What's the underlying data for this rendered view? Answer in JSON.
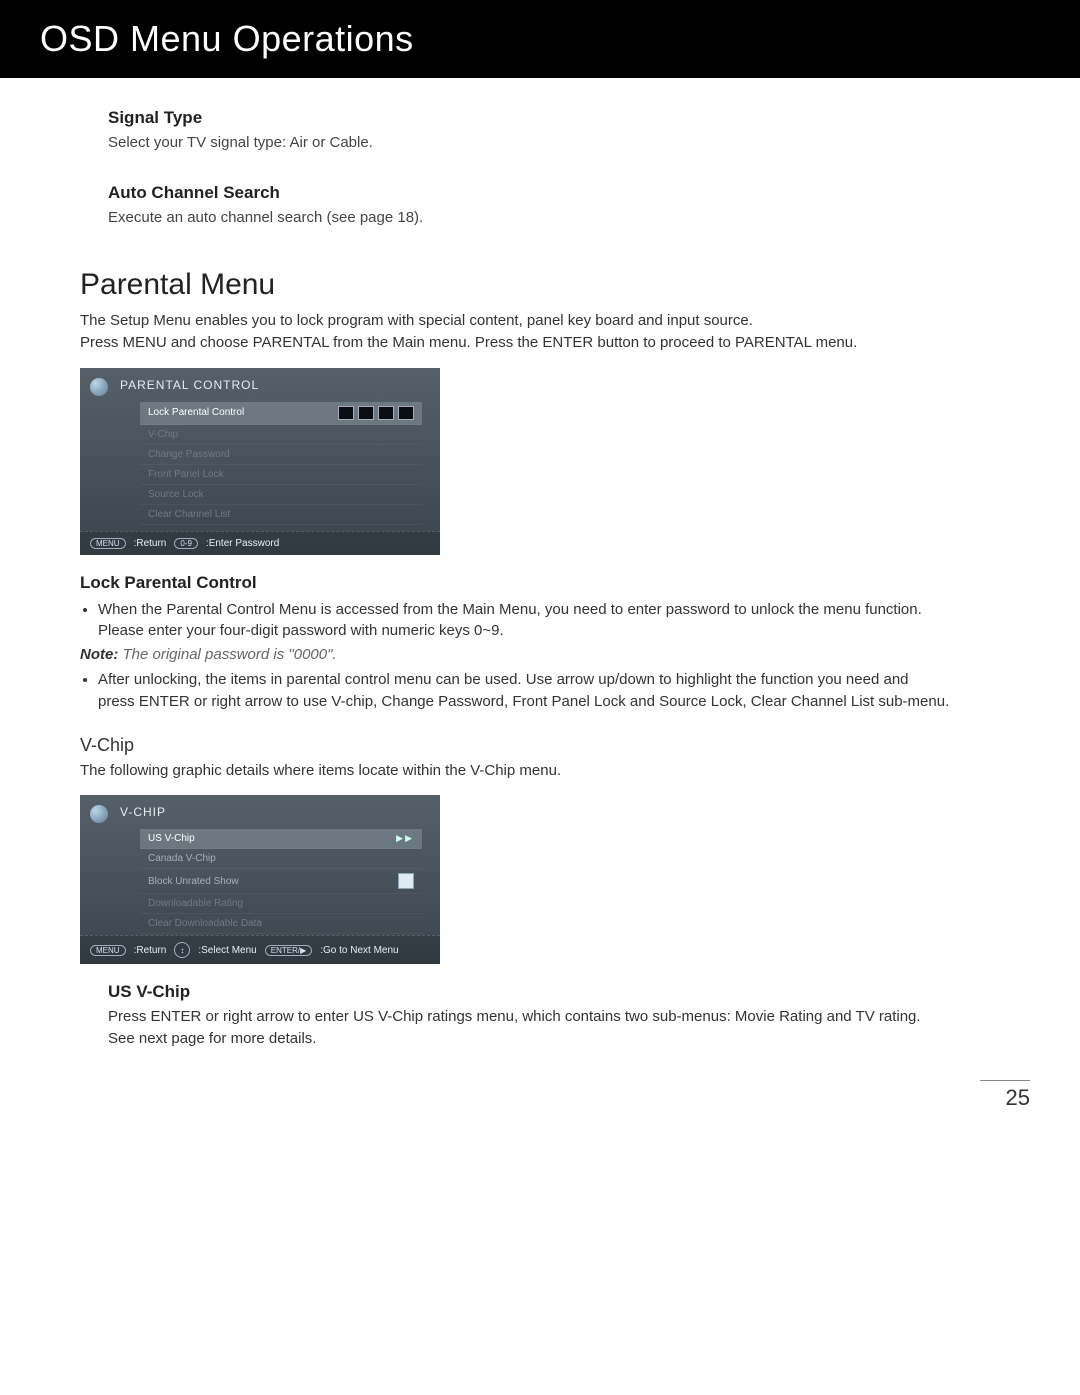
{
  "header": {
    "title": "OSD Menu Operations"
  },
  "signal_type": {
    "title": "Signal Type",
    "body": "Select your TV signal type: Air or Cable."
  },
  "auto_search": {
    "title": "Auto Channel Search",
    "body": "Execute an auto channel search (see page 18)."
  },
  "parental": {
    "heading": "Parental Menu",
    "intro1": "The Setup Menu enables you to lock program with special content, panel key board and input source.",
    "intro2": "Press MENU and choose PARENTAL from the Main menu. Press the ENTER button to proceed to PARENTAL menu."
  },
  "osd_parental": {
    "title": "PARENTAL CONTROL",
    "items": [
      {
        "label": "Lock Parental Control",
        "type": "password",
        "selected": true
      },
      {
        "label": "V-Chip",
        "type": "disabled"
      },
      {
        "label": "Change Password",
        "type": "disabled"
      },
      {
        "label": "Front Panel Lock",
        "type": "disabled"
      },
      {
        "label": "Source Lock",
        "type": "disabled"
      },
      {
        "label": "Clear Channel List",
        "type": "disabled"
      }
    ],
    "footer": {
      "btn1": "MENU",
      "f1": ":Return",
      "btn2": "0-9",
      "f2": ":Enter Password"
    }
  },
  "lock_pc": {
    "title": "Lock Parental Control",
    "b1": "When the Parental Control Menu is accessed from the Main Menu, you need to enter password to unlock the menu function.",
    "b1b": "Please enter your four-digit password with numeric keys 0~9.",
    "note_label": "Note:",
    "note_text": " The original password is \"0000\".",
    "b2": "After unlocking, the items in parental control menu can be used. Use arrow up/down to highlight the function you need and",
    "b2b": "press ENTER or right arrow to use V-chip, Change Password, Front Panel Lock and Source Lock, Clear Channel List sub-menu."
  },
  "vchip": {
    "title": "V-Chip",
    "intro": "The following graphic details where items locate within the V-Chip menu."
  },
  "osd_vchip": {
    "title": "V-CHIP",
    "items": [
      {
        "label": "US V-Chip",
        "type": "arrow",
        "selected": true
      },
      {
        "label": "Canada V-Chip",
        "type": "plain"
      },
      {
        "label": "Block Unrated Show",
        "type": "check"
      },
      {
        "label": "Downloadable Rating",
        "type": "disabled"
      },
      {
        "label": "Clear Downloadable Data",
        "type": "disabled"
      }
    ],
    "footer": {
      "btn1": "MENU",
      "f1": ":Return",
      "btn2": "↕",
      "f2": ":Select Menu",
      "btn3": "ENTER/▶",
      "f3": ":Go to Next Menu"
    }
  },
  "us_vchip": {
    "title": "US V-Chip",
    "body1": "Press ENTER or right arrow to enter US V-Chip ratings menu, which contains two sub-menus: Movie Rating and TV rating.",
    "body2": "See next page for more details."
  },
  "page_number": "25"
}
